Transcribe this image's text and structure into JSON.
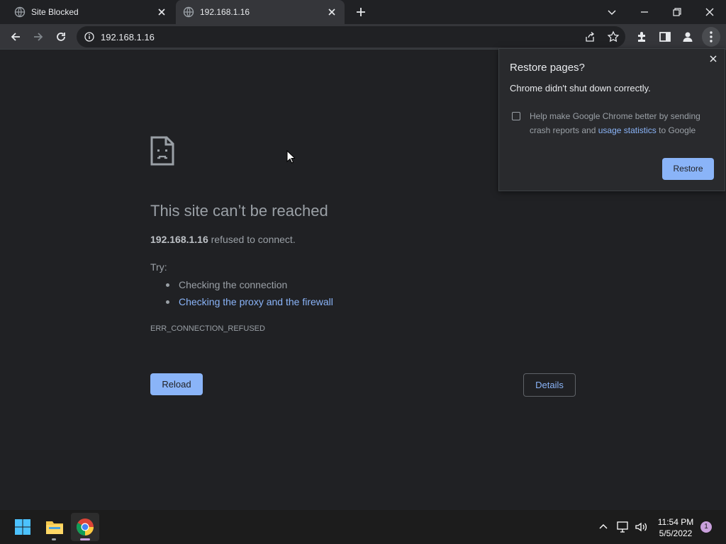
{
  "tabs": [
    {
      "title": "Site Blocked",
      "active": false
    },
    {
      "title": "192.168.1.16",
      "active": true
    }
  ],
  "toolbar": {
    "url": "192.168.1.16"
  },
  "error_page": {
    "title": "This site can’t be reached",
    "host": "192.168.1.16",
    "message": "refused to connect.",
    "try_label": "Try:",
    "suggestions": [
      "Checking the connection",
      "Checking the proxy and the firewall"
    ],
    "error_code": "ERR_CONNECTION_REFUSED",
    "reload_label": "Reload",
    "details_label": "Details"
  },
  "restore_popup": {
    "title": "Restore pages?",
    "subtitle": "Chrome didn't shut down correctly.",
    "checkbox_text_before": "Help make Google Chrome better by sending crash reports and",
    "link_text": "usage statistics",
    "checkbox_text_after": "to Google",
    "checkbox_checked": false,
    "restore_label": "Restore"
  },
  "taskbar": {
    "time": "11:54 PM",
    "date": "5/5/2022",
    "notification_count": "1"
  },
  "colors": {
    "background": "#202124",
    "toolbar": "#35363a",
    "accent_blue": "#8ab4f8",
    "text_secondary": "#9aa0a6"
  }
}
